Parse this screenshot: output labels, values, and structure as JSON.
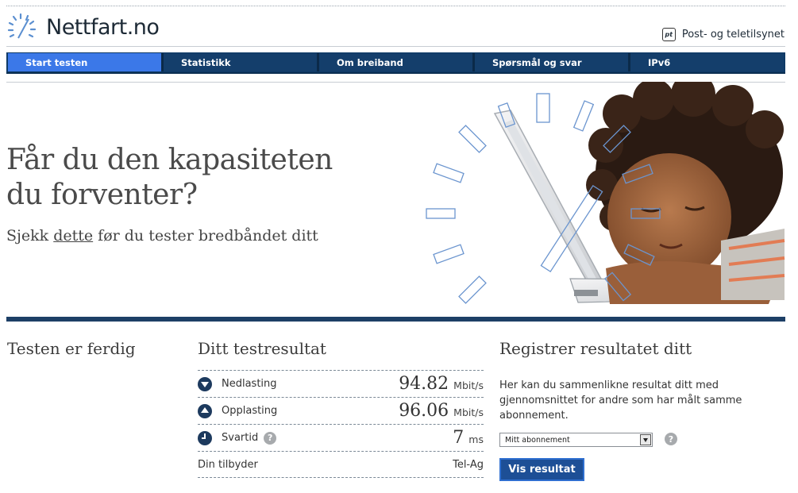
{
  "header": {
    "logo_text": "Nettfart.no",
    "partner_badge": "pt",
    "partner_name": "Post- og teletilsynet"
  },
  "nav": {
    "items": [
      {
        "label": "Start testen",
        "active": true
      },
      {
        "label": "Statistikk",
        "active": false
      },
      {
        "label": "Om breiband",
        "active": false
      },
      {
        "label": "Spørsmål og svar",
        "active": false
      },
      {
        "label": "IPv6",
        "active": false
      }
    ]
  },
  "hero": {
    "title": "Får du den kapasiteten du forventer?",
    "sub_before": "Sjekk ",
    "sub_link": "dette",
    "sub_after": " før du tester bredbåndet ditt"
  },
  "status": {
    "heading": "Testen er ferdig"
  },
  "results": {
    "heading": "Ditt testresultat",
    "download": {
      "label": "Nedlasting",
      "value": "94.82",
      "unit": "Mbit/s",
      "icon": "download-icon"
    },
    "upload": {
      "label": "Opplasting",
      "value": "96.06",
      "unit": "Mbit/s",
      "icon": "upload-icon"
    },
    "latency": {
      "label": "Svartid",
      "help": "?",
      "value": "7",
      "unit": "ms",
      "icon": "clock-icon"
    },
    "provider": {
      "label": "Din tilbyder",
      "value": "Tel-Ag"
    }
  },
  "register": {
    "heading": "Registrer resultatet ditt",
    "text": "Her kan du sammenlikne resultat ditt med gjennomsnittet for andre som har målt samme abonnement.",
    "select_value": "Mitt abonnement",
    "help": "?",
    "button": "Vis resultat"
  },
  "colors": {
    "nav_bg": "#0f3a66",
    "nav_active": "#3b78e8",
    "bar": "#1d3f66",
    "button": "#1d4f96"
  }
}
